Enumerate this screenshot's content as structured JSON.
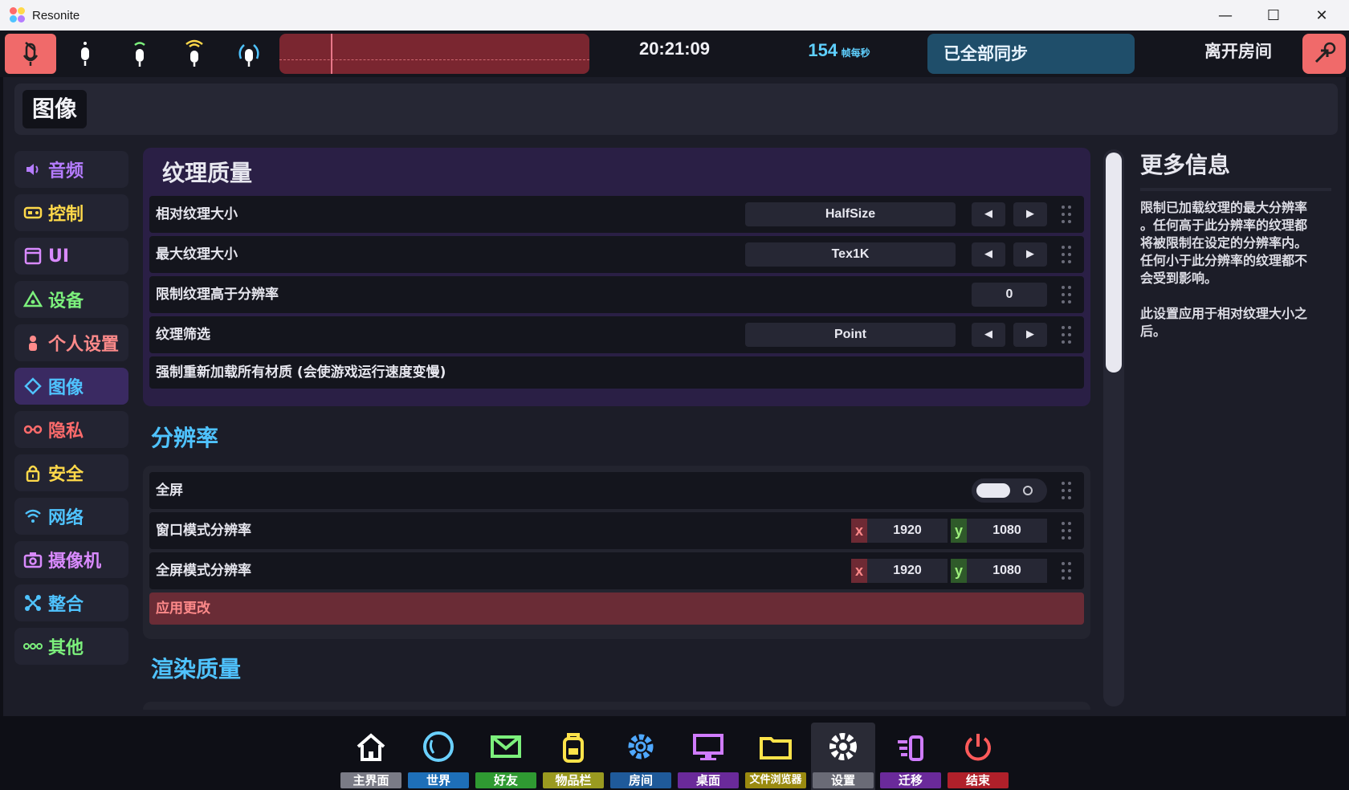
{
  "window": {
    "title": "Resonite"
  },
  "topbar": {
    "clock": "20:21:09",
    "fps_value": "154",
    "fps_unit": "帧每秒",
    "sync_status": "已全部同步",
    "leave_label": "离开房间"
  },
  "header": {
    "title": "图像"
  },
  "sidebar": {
    "items": [
      {
        "label": "音频",
        "icon": "speaker-icon",
        "color": "#b57cff"
      },
      {
        "label": "控制",
        "icon": "gamepad-icon",
        "color": "#ffd94a"
      },
      {
        "label": "UI",
        "icon": "window-icon",
        "color": "#d98aff"
      },
      {
        "label": "设备",
        "icon": "devices-icon",
        "color": "#7cf07c"
      },
      {
        "label": "个人设置",
        "icon": "person-icon",
        "color": "#ff8a8a"
      },
      {
        "label": "图像",
        "icon": "diamond-icon",
        "color": "#4fc3ff"
      },
      {
        "label": "隐私",
        "icon": "glasses-icon",
        "color": "#ff6b6b"
      },
      {
        "label": "安全",
        "icon": "lock-icon",
        "color": "#ffd94a"
      },
      {
        "label": "网络",
        "icon": "wifi-icon",
        "color": "#4fc3ff"
      },
      {
        "label": "摄像机",
        "icon": "camera-icon",
        "color": "#d98aff"
      },
      {
        "label": "整合",
        "icon": "integration-icon",
        "color": "#4fc3ff"
      },
      {
        "label": "其他",
        "icon": "more-icon",
        "color": "#7cf07c"
      }
    ],
    "active_index": 5
  },
  "texture_quality": {
    "title": "纹理质量",
    "relative_size": {
      "label": "相对纹理大小",
      "value": "HalfSize"
    },
    "max_size": {
      "label": "最大纹理大小",
      "value": "Tex1K"
    },
    "limit_above": {
      "label": "限制纹理高于分辨率",
      "value": "0"
    },
    "filtering": {
      "label": "纹理筛选",
      "value": "Point"
    },
    "force_reload": {
      "label": "强制重新加载所有材质 (会使游戏运行速度变慢)"
    }
  },
  "resolution": {
    "title": "分辨率",
    "fullscreen": {
      "label": "全屏",
      "enabled": false
    },
    "windowed": {
      "label": "窗口模式分辨率",
      "x_tag": "x",
      "x": "1920",
      "y_tag": "y",
      "y": "1080"
    },
    "fullscreen_res": {
      "label": "全屏模式分辨率",
      "x_tag": "x",
      "x": "1920",
      "y_tag": "y",
      "y": "1080"
    },
    "apply": {
      "label": "应用更改"
    }
  },
  "render_quality": {
    "title": "渲染质量"
  },
  "info": {
    "title": "更多信息",
    "text": "限制已加载纹理的最大分辨率\n。任何高于此分辨率的纹理都\n将被限制在设定的分辨率内。\n任何小于此分辨率的纹理都不\n会受到影响。\n\n此设置应用于相对纹理大小之\n后。"
  },
  "dock": {
    "items": [
      {
        "label": "主界面",
        "icon": "home-icon",
        "color": "#7a7b86"
      },
      {
        "label": "世界",
        "icon": "world-icon",
        "color": "#1e6fb8"
      },
      {
        "label": "好友",
        "icon": "mail-icon",
        "color": "#2f9a32"
      },
      {
        "label": "物品栏",
        "icon": "backpack-icon",
        "color": "#9a9a20"
      },
      {
        "label": "房间",
        "icon": "cog-icon",
        "color": "#1f5a9a"
      },
      {
        "label": "桌面",
        "icon": "monitor-icon",
        "color": "#6a2a9a"
      },
      {
        "label": "文件浏览器",
        "icon": "folder-icon",
        "color": "#9a8a10"
      },
      {
        "label": "设置",
        "icon": "settings-icon",
        "color": "#6a6b76"
      },
      {
        "label": "迁移",
        "icon": "migrate-icon",
        "color": "#6a2a9a"
      },
      {
        "label": "结束",
        "icon": "power-icon",
        "color": "#b0202a"
      }
    ],
    "active_index": 7
  }
}
